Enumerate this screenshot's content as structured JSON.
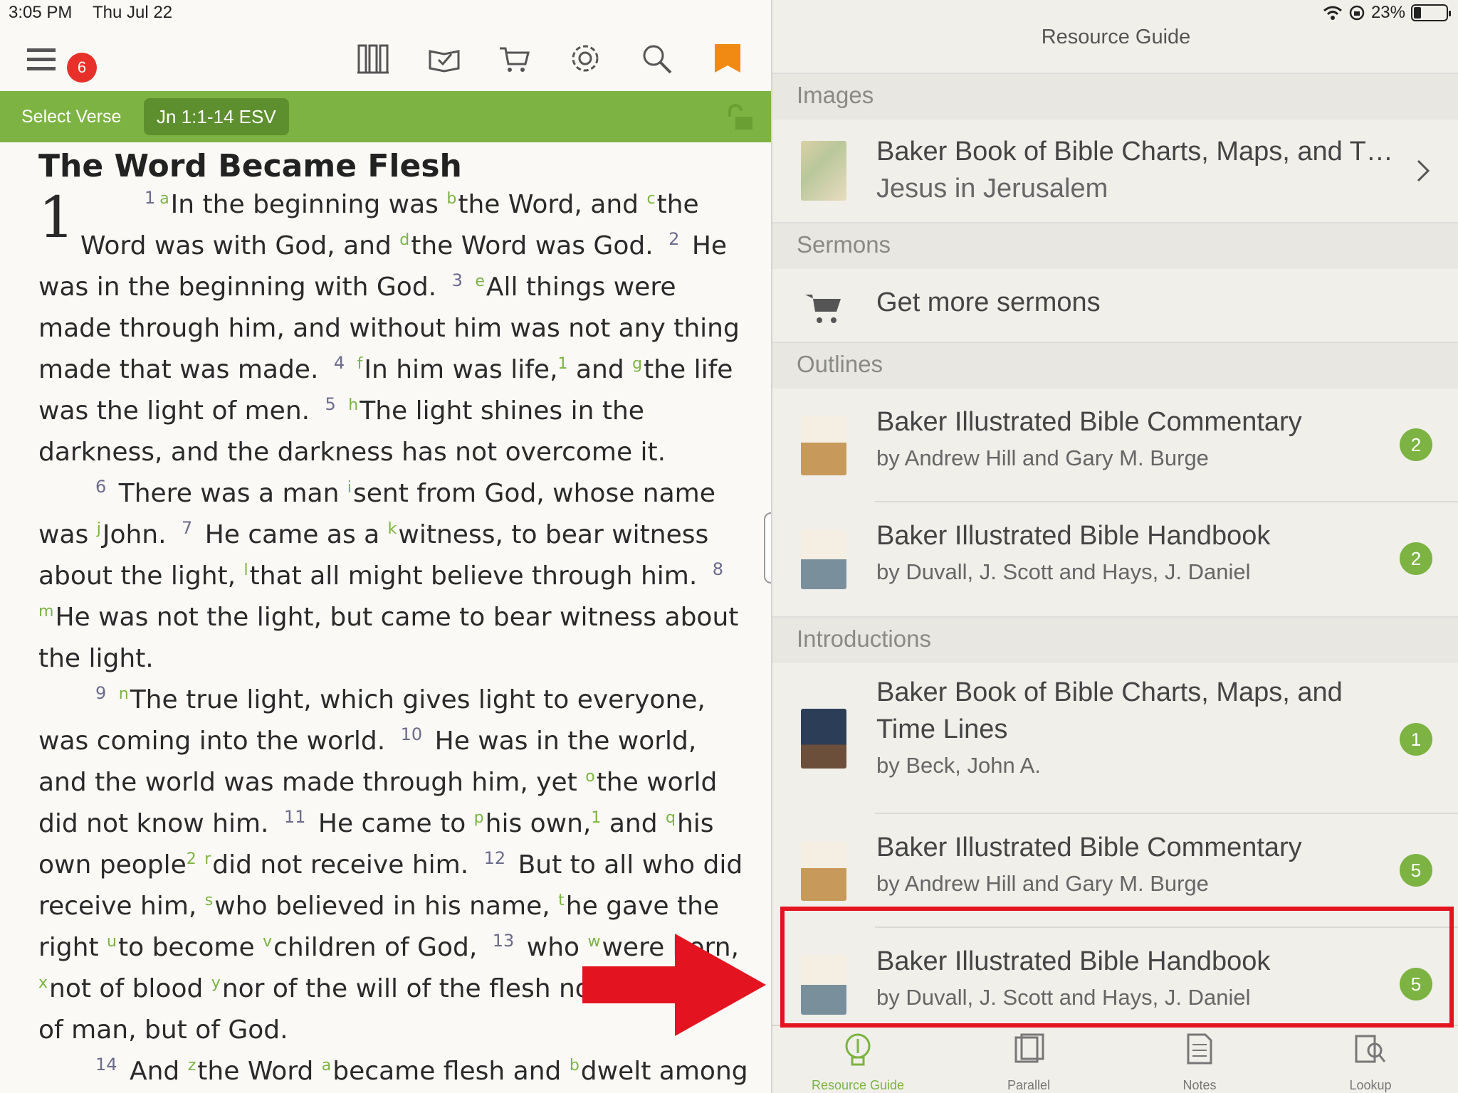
{
  "status": {
    "time": "3:05 PM",
    "date": "Thu Jul 22",
    "battery": "23%",
    "battery_level": 0.23
  },
  "toolbar": {
    "menu_badge": "6"
  },
  "verse_bar": {
    "select_label": "Select Verse",
    "reference": "Jn 1:1-14 ESV"
  },
  "passage": {
    "heading": "The Word Became Flesh",
    "chapter": "1"
  },
  "right": {
    "title": "Resource Guide",
    "sections": {
      "images": "Images",
      "sermons": "Sermons",
      "outlines": "Outlines",
      "introductions": "Introductions"
    },
    "images_row": {
      "title": "Baker Book of Bible Charts, Maps, and T…",
      "sub": "Jesus in Jerusalem"
    },
    "sermons_row": {
      "title": "Get more sermons"
    },
    "outlines": [
      {
        "title": "Baker Illustrated Bible Commentary",
        "sub": "by Andrew Hill and Gary M. Burge",
        "count": "2"
      },
      {
        "title": "Baker Illustrated Bible Handbook",
        "sub": "by Duvall, J. Scott and Hays, J. Daniel",
        "count": "2"
      }
    ],
    "introductions": [
      {
        "title1": "Baker Book of Bible Charts, Maps, and",
        "title2": "Time Lines",
        "sub": "by Beck, John A.",
        "count": "1"
      },
      {
        "title": "Baker Illustrated Bible Commentary",
        "sub": "by Andrew Hill and Gary M. Burge",
        "count": "5"
      },
      {
        "title": "Baker Illustrated Bible Handbook",
        "sub": "by Duvall, J. Scott and Hays, J. Daniel",
        "count": "5"
      }
    ]
  },
  "tabs": [
    {
      "label": "Resource Guide",
      "icon": "lightbulb-icon"
    },
    {
      "label": "Parallel",
      "icon": "books-icon"
    },
    {
      "label": "Notes",
      "icon": "notes-icon"
    },
    {
      "label": "Lookup",
      "icon": "lookup-icon"
    }
  ],
  "colors": {
    "accent": "#7cb342",
    "highlight": "#e3141f",
    "badge": "#e8302a"
  }
}
